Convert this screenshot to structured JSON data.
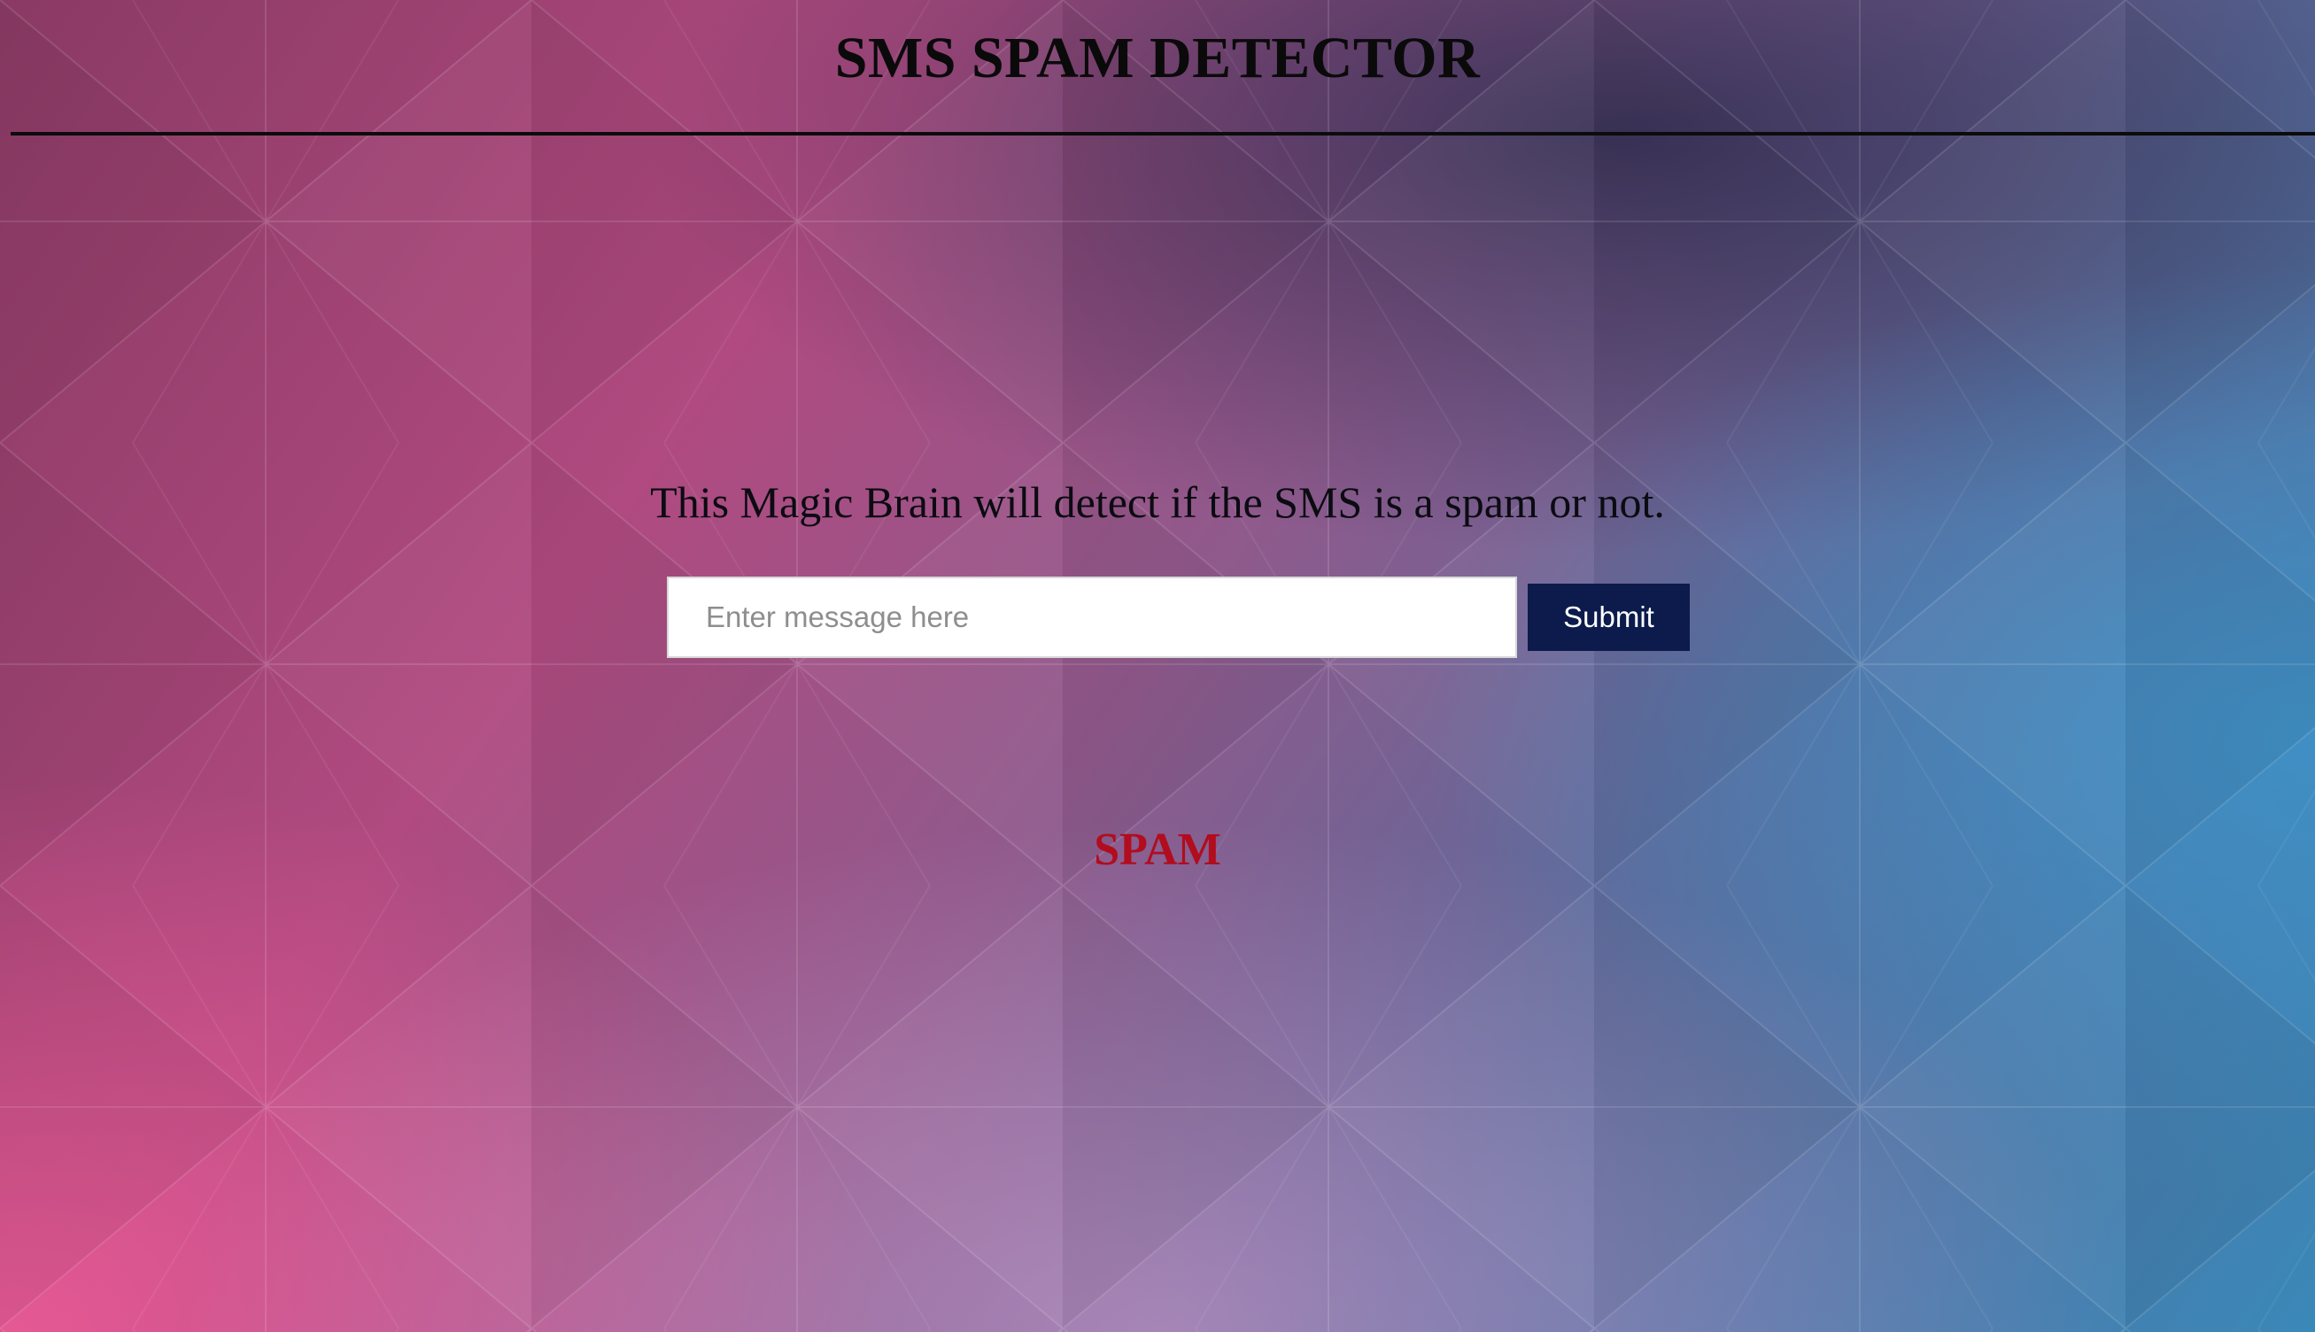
{
  "header": {
    "title": "SMS SPAM DETECTOR"
  },
  "main": {
    "tagline": "This Magic Brain will detect if the SMS is a spam or not.",
    "form": {
      "message_value": "",
      "message_placeholder": "Enter message here",
      "submit_label": "Submit"
    },
    "result": {
      "label": "SPAM",
      "color": "#b10d1e"
    }
  },
  "theme": {
    "submit_button_color": "#0d1b4c",
    "title_color": "#0a0a0a"
  }
}
